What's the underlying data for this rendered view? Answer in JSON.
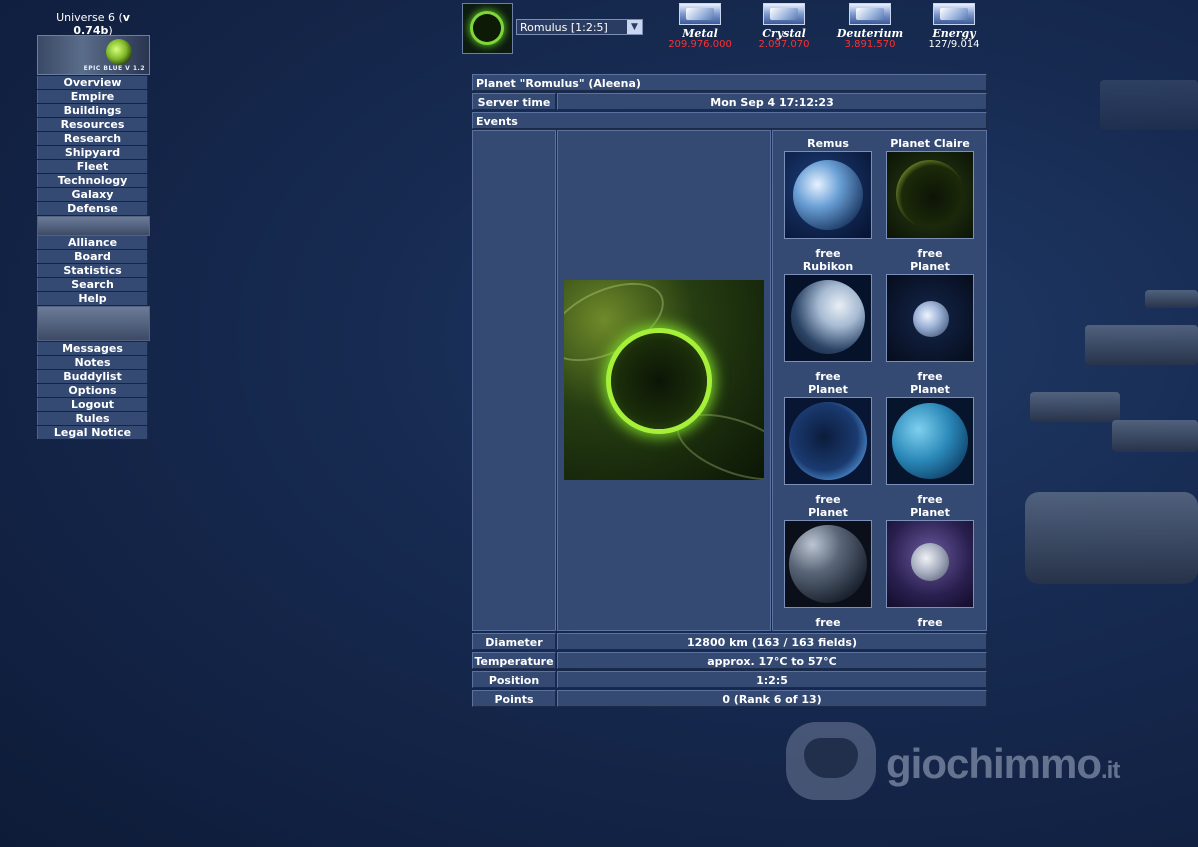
{
  "universe": {
    "prefix": "Universe 6 (",
    "version": "v 0.74b",
    "suffix": ")"
  },
  "logo_text": "EPIC BLUE V 1.2",
  "menu_group1": [
    "Overview",
    "Empire",
    "Buildings",
    "Resources",
    "Research",
    "Shipyard",
    "Fleet",
    "Technology",
    "Galaxy",
    "Defense"
  ],
  "menu_group2": [
    "Alliance",
    "Board",
    "Statistics",
    "Search",
    "Help"
  ],
  "menu_group3": [
    "Messages",
    "Notes",
    "Buddylist",
    "Options",
    "Logout",
    "Rules",
    "Legal Notice"
  ],
  "planet_select": {
    "value": "Romulus [1:2:5]"
  },
  "resources": [
    {
      "label": "Metal",
      "value": "209.976.000",
      "color": "#ff3030"
    },
    {
      "label": "Crystal",
      "value": "2.097.070",
      "color": "#ff3030"
    },
    {
      "label": "Deuterium",
      "value": "3.891.570",
      "color": "#ff3030"
    },
    {
      "label": "Energy",
      "value": "127/9.014",
      "color": "#ffffff"
    }
  ],
  "header": {
    "title": "Planet \"Romulus\" (Aleena)"
  },
  "server_time": {
    "label": "Server time",
    "value": "Mon Sep 4 17:12:23"
  },
  "events": {
    "label": "Events"
  },
  "moons": [
    {
      "name": "Remus",
      "status": "free"
    },
    {
      "name": "Planet Claire",
      "status": "free"
    },
    {
      "name": "Rubikon",
      "status": "free"
    },
    {
      "name": "Planet",
      "status": "free"
    },
    {
      "name": "Planet",
      "status": "free"
    },
    {
      "name": "Planet",
      "status": "free"
    },
    {
      "name": "Planet",
      "status": "free"
    },
    {
      "name": "Planet",
      "status": "free"
    }
  ],
  "info": [
    {
      "label": "Diameter",
      "value": "12800 km (163 / 163 fields)"
    },
    {
      "label": "Temperature",
      "value": "approx. 17°C to 57°C"
    },
    {
      "label": "Position",
      "value": "1:2:5"
    },
    {
      "label": "Points",
      "value": "0 (Rank 6 of 13)"
    }
  ],
  "watermark": {
    "brand": "giochimmo",
    "tld": ".it"
  }
}
